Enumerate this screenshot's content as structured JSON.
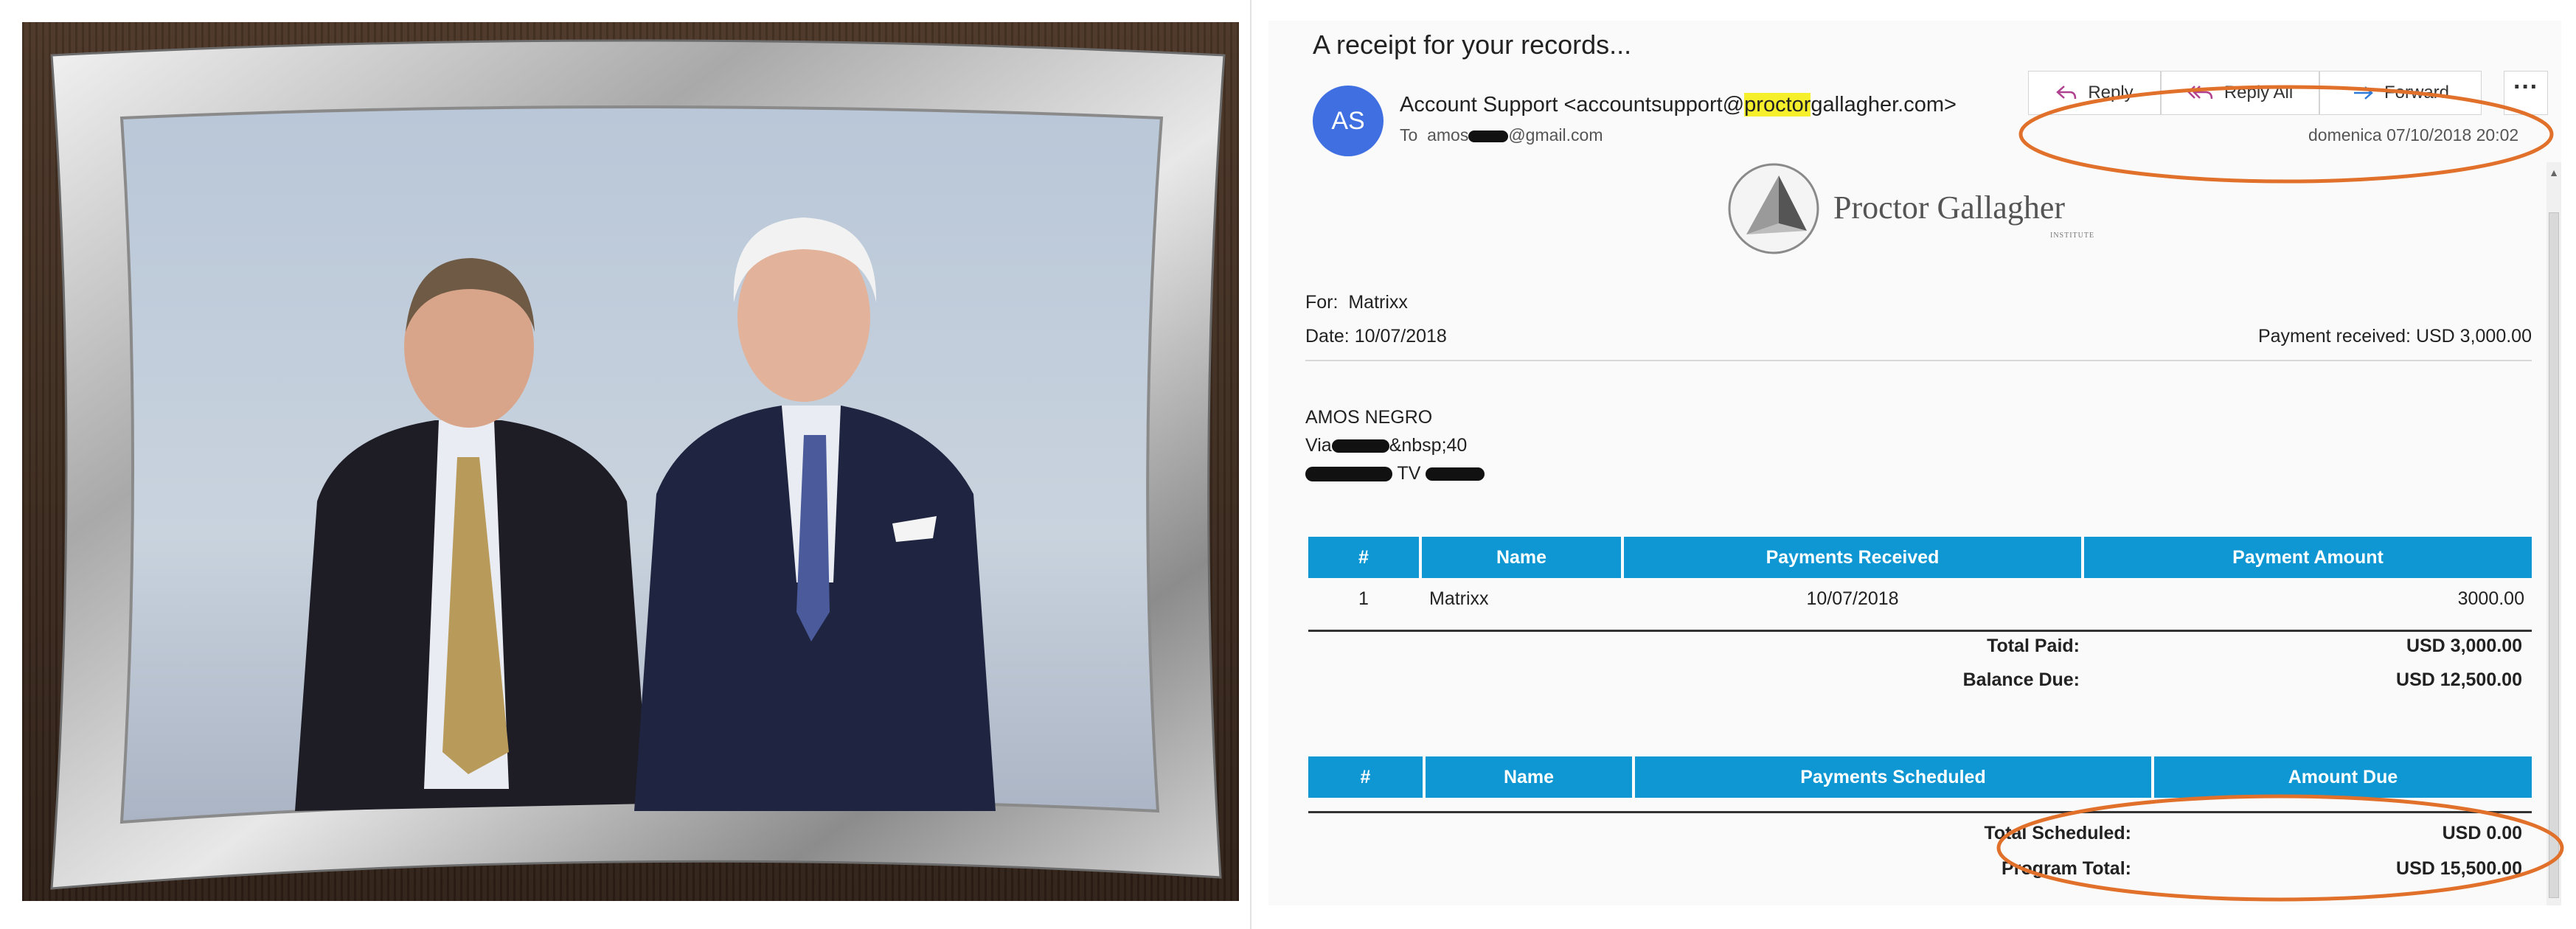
{
  "email": {
    "subject": "A receipt for your records...",
    "avatar_initials": "AS",
    "sender_name": "Account Support <accountsupport@",
    "sender_highlight": "proctor",
    "sender_domain_rest": "gallagher.com>",
    "to_label": "To",
    "to_prefix": "amos",
    "to_suffix": "@gmail.com",
    "actions": {
      "reply": "Reply",
      "reply_all": "Reply All",
      "forward": "Forward",
      "more": "···"
    },
    "date_time": "domenica 07/10/2018 20:02"
  },
  "logo": {
    "name": "Proctor Gallagher",
    "sub": "INSTITUTE"
  },
  "receipt": {
    "for_label": "For:",
    "for_value": "Matrixx",
    "date_label": "Date:",
    "date_value": "10/07/2018",
    "payment_received": "Payment received: USD 3,000.00",
    "address": {
      "name": "AMOS NEGRO",
      "street_prefix": "Via",
      "street_suffix": "&nbsp;40",
      "city_middle": "TV"
    },
    "payments_table": {
      "headers": [
        "#",
        "Name",
        "Payments Received",
        "Payment Amount"
      ],
      "rows": [
        [
          "1",
          "Matrixx",
          "10/07/2018",
          "3000.00"
        ]
      ]
    },
    "total_paid_label": "Total Paid:",
    "total_paid_value": "USD 3,000.00",
    "balance_due_label": "Balance Due:",
    "balance_due_value": "USD 12,500.00",
    "scheduled_table": {
      "headers": [
        "#",
        "Name",
        "Payments Scheduled",
        "Amount Due"
      ]
    },
    "total_scheduled_label": "Total Scheduled:",
    "total_scheduled_value": "USD 0.00",
    "program_total_label": "Program Total:",
    "program_total_value": "USD 15,500.00"
  },
  "colors": {
    "table_header": "#0e97d3",
    "avatar": "#3f6fe0",
    "annotation": "#e0702a",
    "highlight": "#f6ef2b"
  },
  "icons": [
    "reply-icon",
    "reply-all-icon",
    "forward-icon",
    "more-icon",
    "scroll-up-icon",
    "logo-triangle-icon"
  ]
}
